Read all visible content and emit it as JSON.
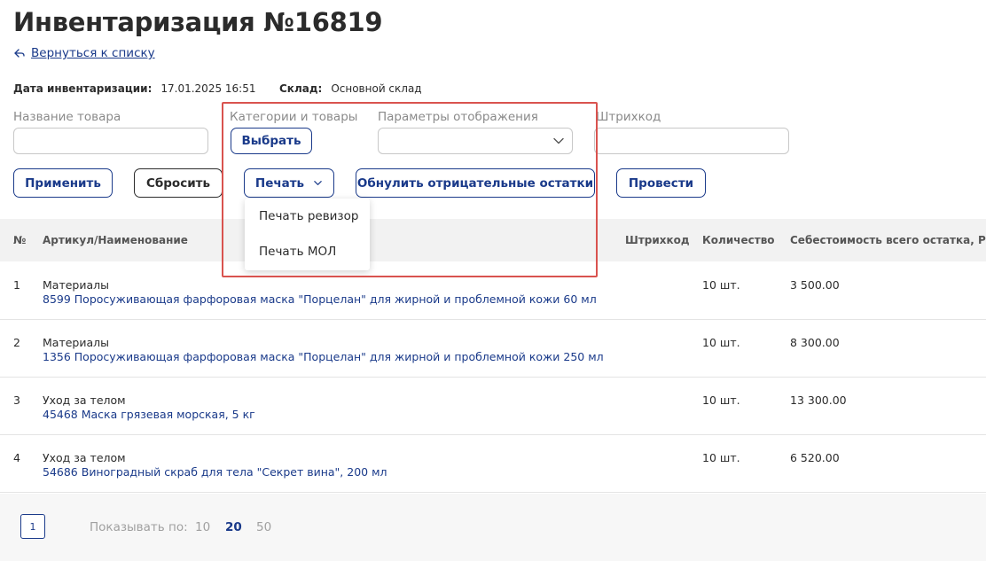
{
  "page": {
    "title": "Инвентаризация №16819",
    "back_label": "Вернуться к списку"
  },
  "meta": {
    "date_label": "Дата инвентаризации:",
    "date_value": "17.01.2025 16:51",
    "warehouse_label": "Склад:",
    "warehouse_value": "Основной склад"
  },
  "filters": {
    "product_name_label": "Название товара",
    "product_name_value": "",
    "product_name_placeholder": "",
    "categories_label": "Категории и товары",
    "choose_button": "Выбрать",
    "display_params_label": "Параметры отображения",
    "display_params_value": "",
    "barcode_label": "Штрихкод",
    "barcode_value": "",
    "barcode_placeholder": ""
  },
  "actions": {
    "apply": "Применить",
    "reset": "Сбросить",
    "print": "Печать",
    "zero_negative": "Обнулить отрицательные остатки",
    "post": "Провести"
  },
  "print_menu": {
    "items": [
      "Печать ревизор",
      "Печать МОЛ"
    ]
  },
  "table": {
    "columns": {
      "num": "№",
      "name": "Артикул/Наименование",
      "barcode": "Штрихкод",
      "qty": "Количество",
      "cost": "Себестоимость всего остатка, Р"
    },
    "rows": [
      {
        "num": "1",
        "category": "Материалы",
        "product": "8599 Поросуживающая фарфоровая маска \"Порцелан\" для жирной и проблемной кожи 60 мл",
        "barcode": "",
        "qty": "10 шт.",
        "cost": "3 500.00"
      },
      {
        "num": "2",
        "category": "Материалы",
        "product": "1356 Поросуживающая фарфоровая маска \"Порцелан\" для жирной и проблемной кожи 250 мл",
        "barcode": "",
        "qty": "10 шт.",
        "cost": "8 300.00"
      },
      {
        "num": "3",
        "category": "Уход за телом",
        "product": "45468 Маска грязевая морская, 5 кг",
        "barcode": "",
        "qty": "10 шт.",
        "cost": "13 300.00"
      },
      {
        "num": "4",
        "category": "Уход за телом",
        "product": "54686 Виноградный скраб для тела \"Секрет вина\", 200 мл",
        "barcode": "",
        "qty": "10 шт.",
        "cost": "6 520.00"
      }
    ]
  },
  "pagination": {
    "current_page": "1",
    "show_label": "Показывать по:",
    "sizes": [
      "10",
      "20",
      "50"
    ],
    "active_size": "20"
  },
  "colors": {
    "accent": "#1a3a8a",
    "highlight": "#d9534f",
    "text": "#2b2b2b",
    "muted": "#8a8a8a"
  },
  "icons": {
    "back": "back-arrow-icon",
    "chevron": "chevron-down-icon"
  }
}
